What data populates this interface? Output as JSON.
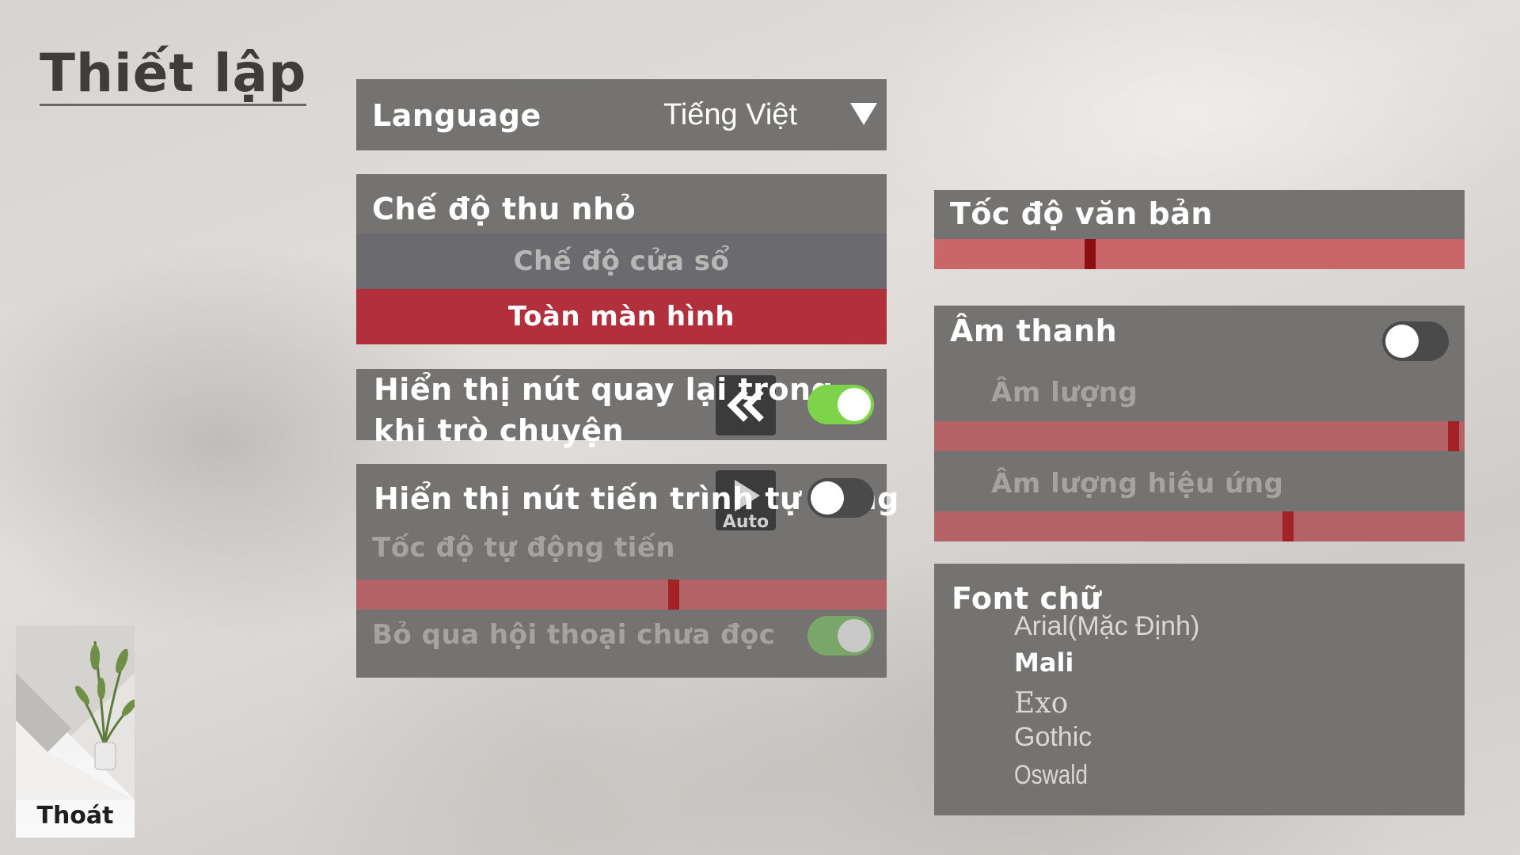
{
  "page": {
    "title": "Thiết lập"
  },
  "language": {
    "label": "Language",
    "value": "Tiếng Việt"
  },
  "display_mode": {
    "label": "Chế độ thu nhỏ",
    "options": [
      "Chế độ cửa sổ",
      "Toàn màn hình"
    ],
    "selected": "Toàn màn hình"
  },
  "back_button": {
    "label": "Hiển thị nút quay lại trong khi trò chuyện",
    "icon": "double-chevron-left-icon",
    "enabled": true
  },
  "auto_button": {
    "label": "Hiển thị nút tiến trình tự động",
    "icon": "play-icon",
    "icon_caption": "Auto",
    "enabled": false,
    "auto_speed_label": "Tốc độ tự động tiến",
    "auto_speed_value": 0.6,
    "skip_unread_label": "Bỏ qua hội thoại chưa đọc",
    "skip_unread_enabled": true
  },
  "text_speed": {
    "label": "Tốc độ văn bản",
    "value": 0.29
  },
  "sound": {
    "label": "Âm thanh",
    "enabled": false,
    "volume_label": "Âm lượng",
    "volume_value": 0.99,
    "effects_label": "Âm lượng hiệu ứng",
    "effects_value": 0.67
  },
  "font": {
    "label": "Font chữ",
    "options": [
      "Arial(Mặc Định)",
      "Mali",
      "Exo",
      "Gothic",
      "Oswald"
    ],
    "selected": "Mali"
  },
  "exit": {
    "label": "Thoát"
  },
  "colors": {
    "accent_red": "#b22f3c",
    "toggle_on": "#7dd44a",
    "panel": "#747372",
    "slider": "#c96669"
  }
}
